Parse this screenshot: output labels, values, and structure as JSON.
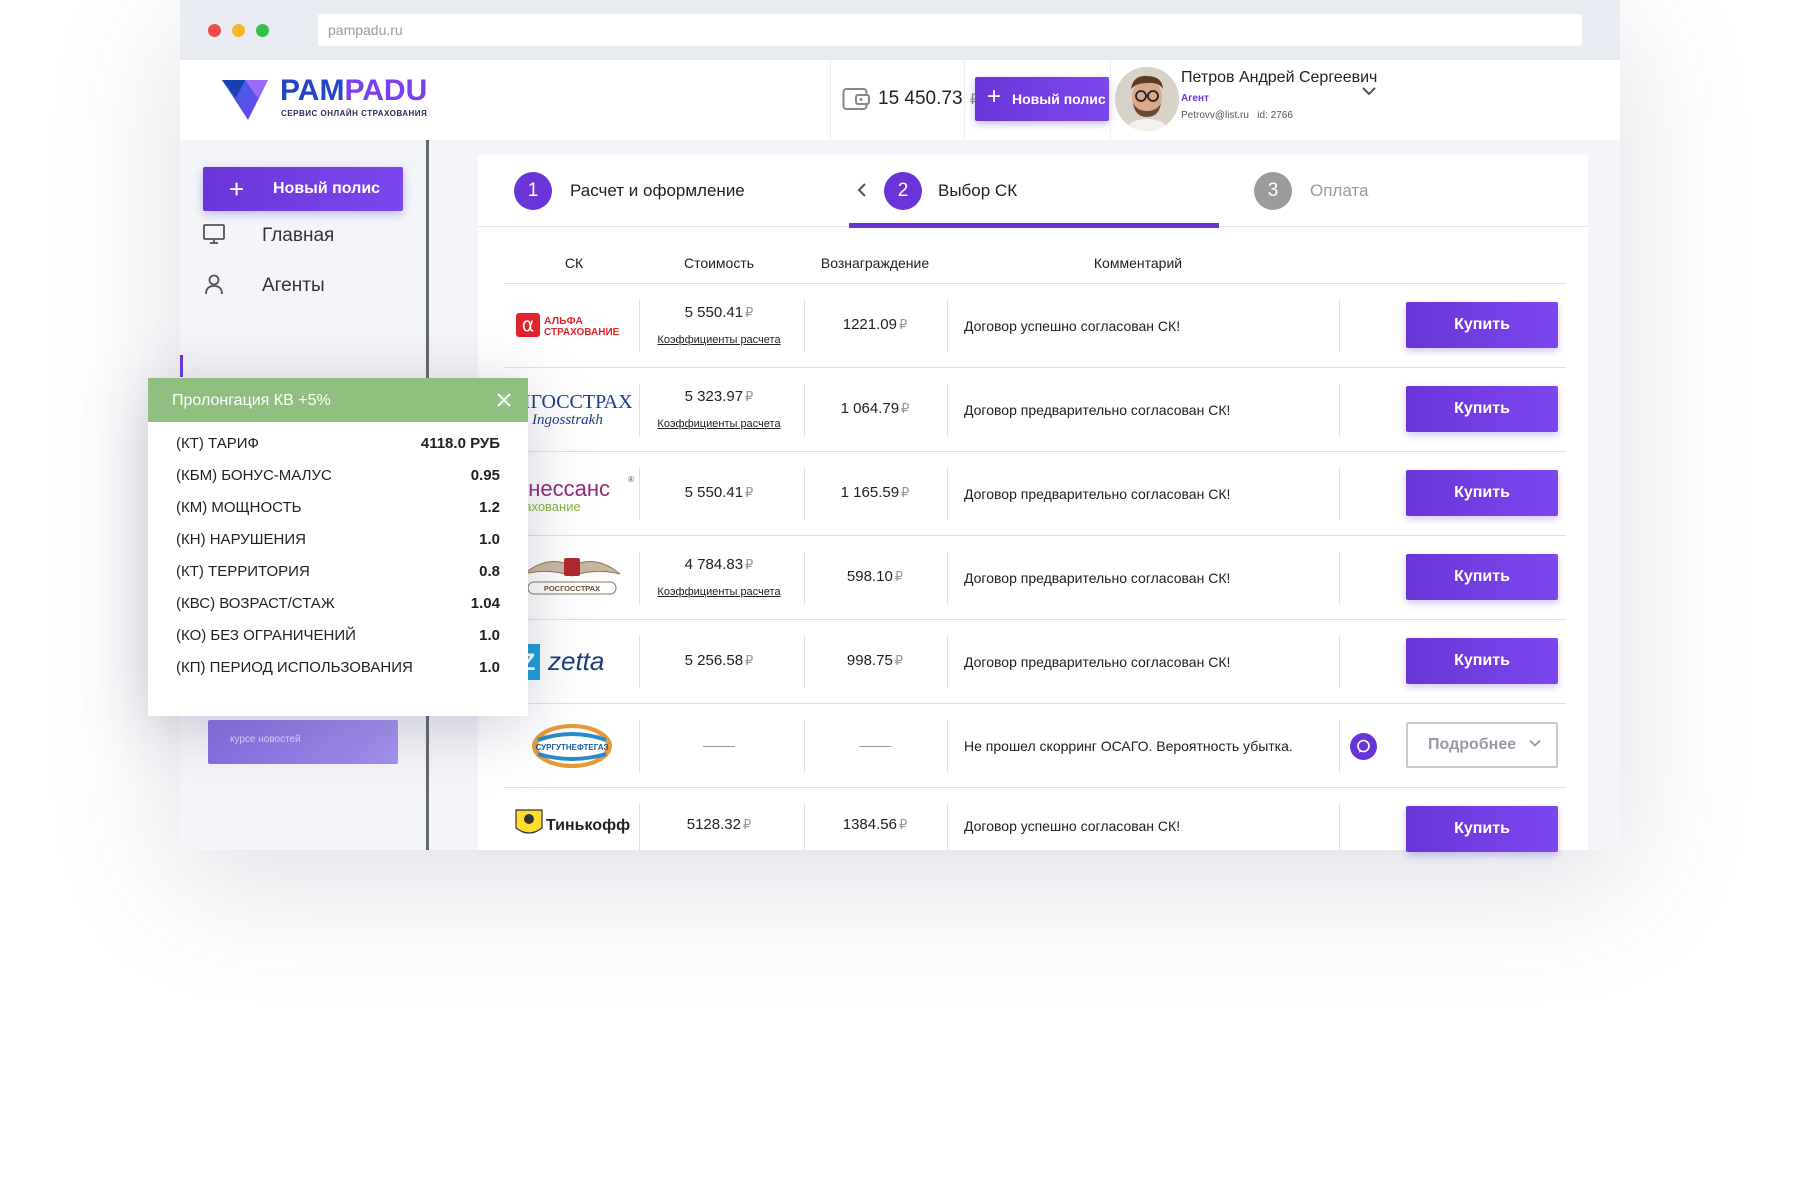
{
  "browser": {
    "url": "pampadu.ru"
  },
  "brand": {
    "name_part1": "PAM",
    "name_part2": "PADU",
    "tagline": "СЕРВИС ОНЛАЙН СТРАХОВАНИЯ"
  },
  "header": {
    "balance": "15 450.73",
    "currency": "₽",
    "new_policy_label": "Новый полис",
    "user": {
      "name": "Петров Андрей Сергеевич",
      "role": "Агент",
      "email": "Petrovv@list.ru",
      "id": "id: 2766"
    }
  },
  "sidebar": {
    "new_policy_label": "Новый полис",
    "items": [
      {
        "label": "Главная",
        "icon": "monitor-icon"
      },
      {
        "label": "Агенты",
        "icon": "user-icon"
      }
    ],
    "promo_text": "курсе новостей"
  },
  "steps": [
    {
      "num": "1",
      "label": "Расчет и оформление",
      "state": "done"
    },
    {
      "num": "2",
      "label": "Выбор СК",
      "state": "active"
    },
    {
      "num": "3",
      "label": "Оплата",
      "state": "pending"
    }
  ],
  "table": {
    "headers": [
      "СК",
      "Стоимость",
      "Вознаграждение",
      "Комментарий"
    ],
    "coef_link": "Коэффициенты расчета",
    "buy_label": "Купить",
    "details_label": "Подробнее",
    "rows": [
      {
        "company": "Альфа Страхование",
        "logo_text": "АЛЬФА СТРАХОВАНИЕ",
        "price": "5 550.41",
        "price_cur": "₽",
        "coef": true,
        "reward": "1221.09",
        "reward_cur": "₽",
        "comment": "Договор успешно согласован СК!",
        "action": "buy"
      },
      {
        "company": "Ингосстрах",
        "logo_text": "НГОССТРАХ",
        "logo_sub": "Ingosstrakh",
        "price": "5 323.97",
        "price_cur": "₽",
        "coef": true,
        "reward": "1 064.79",
        "reward_cur": "₽",
        "comment": "Договор предварительно согласован СК!",
        "action": "buy"
      },
      {
        "company": "Ренессанс Страхование",
        "logo_text": "енессанс",
        "logo_sub": "рахование",
        "price": "5 550.41",
        "price_cur": "₽",
        "coef": false,
        "reward": "1 165.59",
        "reward_cur": "₽",
        "comment": "Договор предварительно согласован СК!",
        "action": "buy"
      },
      {
        "company": "Росгосстрах",
        "logo_text": "РОСГОССТРАХ",
        "price": "4 784.83",
        "price_cur": "₽",
        "coef": true,
        "reward": "598.10",
        "reward_cur": "₽",
        "comment": "Договор предварительно согласован СК!",
        "action": "buy"
      },
      {
        "company": "Zetta",
        "logo_text": "zetta",
        "price": "5 256.58",
        "price_cur": "₽",
        "coef": false,
        "reward": "998.75",
        "reward_cur": "₽",
        "comment": "Договор предварительно согласован СК!",
        "action": "buy"
      },
      {
        "company": "Сургутнефтегаз",
        "logo_text": "СУРГУТНЕФТЕГАЗ",
        "price": "",
        "price_cur": "",
        "coef": false,
        "reward": "",
        "reward_cur": "",
        "comment": "Не прошел скорринг ОСАГО. Вероятность убытка.",
        "action": "details"
      },
      {
        "company": "Тинькофф",
        "logo_text": "Тинькофф",
        "price": "5128.32",
        "price_cur": "₽",
        "coef": false,
        "reward": "1384.56",
        "reward_cur": "₽",
        "comment": "Договор успешно согласован СК!",
        "action": "buy"
      }
    ]
  },
  "popup": {
    "title": "Пролонгация КВ +5%",
    "rows": [
      {
        "k": "(КТ) ТАРИФ",
        "v": "4118.0 РУБ"
      },
      {
        "k": "(КБМ) БОНУС-МАЛУС",
        "v": "0.95"
      },
      {
        "k": "(КМ) МОЩНОСТЬ",
        "v": "1.2"
      },
      {
        "k": "(КН) НАРУШЕНИЯ",
        "v": "1.0"
      },
      {
        "k": "(КТ) ТЕРРИТОРИЯ",
        "v": "0.8"
      },
      {
        "k": "(КВС) ВОЗРАСТ/СТАЖ",
        "v": "1.04"
      },
      {
        "k": "(КО) БЕЗ ОГРАНИЧЕНИЙ",
        "v": "1.0"
      },
      {
        "k": "(КП) ПЕРИОД ИСПОЛЬЗОВАНИЯ",
        "v": "1.0"
      }
    ]
  },
  "colors": {
    "accent": "#6a35d8",
    "popup_head": "#8fc07f",
    "step_pending": "#9b9b9b"
  }
}
